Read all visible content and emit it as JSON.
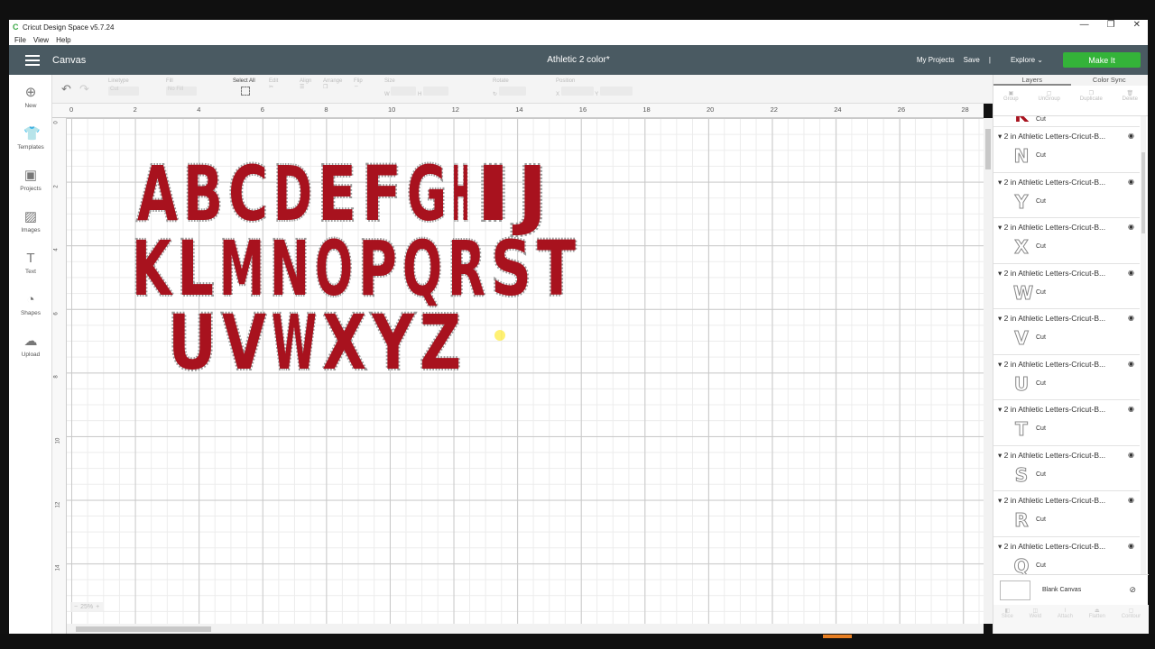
{
  "window": {
    "title": "Cricut Design Space  v5.7.24",
    "controls": [
      "—",
      "❐",
      "✕"
    ]
  },
  "menu": [
    "File",
    "View",
    "Help"
  ],
  "header": {
    "section": "Canvas",
    "doc_title": "Athletic 2 color*",
    "my_projects": "My Projects",
    "save": "Save",
    "separator": "|",
    "explore": "Explore",
    "make_it": "Make It"
  },
  "sidebar": [
    {
      "label": "New",
      "icon": "plus-circle-icon"
    },
    {
      "label": "Templates",
      "icon": "shirt-icon"
    },
    {
      "label": "Projects",
      "icon": "projects-icon"
    },
    {
      "label": "Images",
      "icon": "image-icon"
    },
    {
      "label": "Text",
      "icon": "text-icon"
    },
    {
      "label": "Shapes",
      "icon": "shapes-icon"
    },
    {
      "label": "Upload",
      "icon": "upload-icon"
    }
  ],
  "toolbar": {
    "linetype": "Linetype",
    "linetype_val": "Cut",
    "fill": "Fill",
    "fill_val": "No Fill",
    "select_all": "Select All",
    "edit": "Edit",
    "align": "Align",
    "arrange": "Arrange",
    "flip": "Flip",
    "size": "Size",
    "w": "W",
    "h": "H",
    "rotate": "Rotate",
    "position": "Position",
    "x": "X",
    "y": "Y"
  },
  "ruler_top": [
    "0",
    "2",
    "4",
    "6",
    "8",
    "10",
    "12",
    "14",
    "16",
    "18",
    "20",
    "22",
    "24",
    "26",
    "28"
  ],
  "ruler_left": [
    "0",
    "2",
    "4",
    "6",
    "8",
    "10",
    "12",
    "14"
  ],
  "canvas": {
    "rows": [
      "ABCDEFGHIJ",
      "KLMNOPQRST",
      "UVWXYZ"
    ],
    "fill_color": "#a8121e",
    "stroke_color": "#9a9a9a"
  },
  "zoom": {
    "minus": "−",
    "value": "25%",
    "plus": "+"
  },
  "right_panel": {
    "tabs": [
      "Layers",
      "Color Sync"
    ],
    "actions": [
      "Group",
      "UnGroup",
      "Duplicate",
      "Delete"
    ],
    "layers": [
      {
        "name": "2 in Athletic Letters-Cricut-B...",
        "glyph": "N",
        "op": "Cut"
      },
      {
        "name": "2 in Athletic Letters-Cricut-B...",
        "glyph": "Y",
        "op": "Cut"
      },
      {
        "name": "2 in Athletic Letters-Cricut-B...",
        "glyph": "X",
        "op": "Cut"
      },
      {
        "name": "2 in Athletic Letters-Cricut-B...",
        "glyph": "W",
        "op": "Cut"
      },
      {
        "name": "2 in Athletic Letters-Cricut-B...",
        "glyph": "V",
        "op": "Cut"
      },
      {
        "name": "2 in Athletic Letters-Cricut-B...",
        "glyph": "U",
        "op": "Cut"
      },
      {
        "name": "2 in Athletic Letters-Cricut-B...",
        "glyph": "T",
        "op": "Cut"
      },
      {
        "name": "2 in Athletic Letters-Cricut-B...",
        "glyph": "S",
        "op": "Cut"
      },
      {
        "name": "2 in Athletic Letters-Cricut-B...",
        "glyph": "R",
        "op": "Cut"
      },
      {
        "name": "2 in Athletic Letters-Cricut-B...",
        "glyph": "Q",
        "op": "Cut"
      }
    ],
    "top_partial": {
      "glyph": "K",
      "op": "Cut"
    },
    "blank_canvas": "Blank Canvas",
    "bottom_actions": [
      "Slice",
      "Weld",
      "Attach",
      "Flatten",
      "Contour"
    ]
  }
}
